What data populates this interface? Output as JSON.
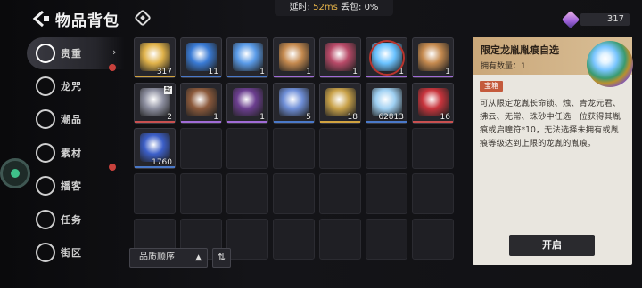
{
  "header": {
    "title": "物品背包",
    "ping_label": "延时:",
    "ping_value": "52ms",
    "loss_label": "丢包:",
    "loss_value": "0%",
    "currency_count": "317"
  },
  "sidebar": {
    "items": [
      {
        "label": "贵重",
        "icon": "valuable-icon",
        "active": true,
        "badge": true
      },
      {
        "label": "龙咒",
        "icon": "dragon-curse-icon",
        "active": false,
        "badge": false
      },
      {
        "label": "潮品",
        "icon": "fashion-icon",
        "active": false,
        "badge": false
      },
      {
        "label": "素材",
        "icon": "material-icon",
        "active": false,
        "badge": true
      },
      {
        "label": "播客",
        "icon": "podcast-icon",
        "active": false,
        "badge": false
      },
      {
        "label": "任务",
        "icon": "task-icon",
        "active": false,
        "badge": false
      },
      {
        "label": "街区",
        "icon": "district-icon",
        "active": false,
        "badge": false
      }
    ],
    "arrow": "›"
  },
  "inventory": {
    "items": [
      {
        "count": "317",
        "color": "#e0b24a",
        "rarity": "#d1a340"
      },
      {
        "count": "11",
        "color": "#3a7bd5",
        "rarity": "#4a79c9"
      },
      {
        "count": "1",
        "color": "#5a9be8",
        "rarity": "#4a79c9"
      },
      {
        "count": "1",
        "color": "#c58a4f",
        "rarity": "#a06bd6"
      },
      {
        "count": "1",
        "color": "#b84a68",
        "rarity": "#a06bd6"
      },
      {
        "count": "1",
        "color": "#6ac2ff",
        "rarity": "#a06bd6"
      },
      {
        "count": "1",
        "color": "#c58a4f",
        "rarity": "#a06bd6"
      },
      {
        "count": "2",
        "color": "#8d8fa0",
        "rarity": "#c95050",
        "new": "新"
      },
      {
        "count": "1",
        "color": "#8c5a3c",
        "rarity": "#a06bd6"
      },
      {
        "count": "1",
        "color": "#6b3e8f",
        "rarity": "#a06bd6"
      },
      {
        "count": "5",
        "color": "#6f8fd8",
        "rarity": "#4a79c9"
      },
      {
        "count": "18",
        "color": "#c9a24a",
        "rarity": "#d1a340"
      },
      {
        "count": "62813",
        "color": "#9fd0f2",
        "rarity": "#4a79c9"
      },
      {
        "count": "16",
        "color": "#c8343c",
        "rarity": "#c95050"
      },
      {
        "count": "1760",
        "color": "#3c5fc8",
        "rarity": "#4a79c9"
      }
    ]
  },
  "sort": {
    "label": "品质顺序",
    "caret": "▲",
    "toggle": "⇅"
  },
  "detail": {
    "name": "限定龙胤胤痕自选",
    "owned": "拥有数量：1",
    "tag": "宝箱",
    "description": "可从限定龙胤长命锁、烛、青龙元君、拂云、无常、珠砂中任选一位获得其胤痕或启瞳符*10，无法选择未拥有或胤痕等级达到上限的龙胤的胤痕。",
    "button": "开启"
  }
}
